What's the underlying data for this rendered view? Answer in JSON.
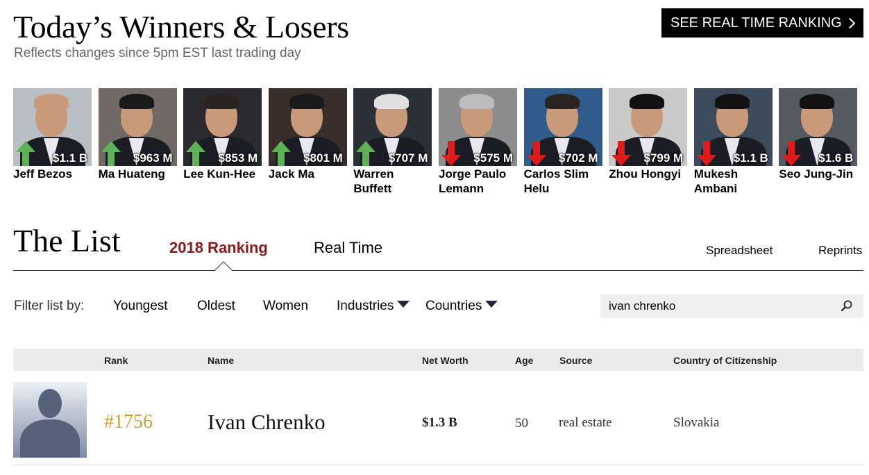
{
  "header": {
    "title": "Today’s Winners & Losers",
    "subtitle": "Reflects changes since 5pm EST last trading day",
    "realtime_button": "SEE REAL TIME RANKING"
  },
  "colors": {
    "gain": "#5fb157",
    "loss": "#e01b1b",
    "tab_active": "#8b1a1a",
    "rank": "#c9a237"
  },
  "movers": [
    {
      "name": "Jeff Bezos",
      "change": "$1.1 B",
      "direction": "up"
    },
    {
      "name": "Ma Huateng",
      "change": "$963 M",
      "direction": "up"
    },
    {
      "name": "Lee Kun-Hee",
      "change": "$853 M",
      "direction": "up"
    },
    {
      "name": "Jack Ma",
      "change": "$801 M",
      "direction": "up"
    },
    {
      "name": "Warren Buffett",
      "change": "$707 M",
      "direction": "up"
    },
    {
      "name": "Jorge Paulo Lemann",
      "change": "$575 M",
      "direction": "down"
    },
    {
      "name": "Carlos Slim Helu",
      "change": "$702 M",
      "direction": "down"
    },
    {
      "name": "Zhou Hongyi",
      "change": "$799 M",
      "direction": "down"
    },
    {
      "name": "Mukesh Ambani",
      "change": "$1.1 B",
      "direction": "down"
    },
    {
      "name": "Seo Jung-Jin",
      "change": "$1.6 B",
      "direction": "down"
    }
  ],
  "list": {
    "title": "The List",
    "tabs": {
      "ranking": "2018 Ranking",
      "realtime": "Real Time"
    },
    "links": {
      "spreadsheet": "Spreadsheet",
      "reprints": "Reprints"
    }
  },
  "filters": {
    "label": "Filter list by:",
    "youngest": "Youngest",
    "oldest": "Oldest",
    "women": "Women",
    "industries": "Industries",
    "countries": "Countries"
  },
  "search": {
    "value": "ivan chrenko"
  },
  "table": {
    "headers": {
      "rank": "Rank",
      "name": "Name",
      "net_worth": "Net Worth",
      "age": "Age",
      "source": "Source",
      "country": "Country of Citizenship"
    },
    "rows": [
      {
        "rank": "#1756",
        "name": "Ivan Chrenko",
        "net_worth": "$1.3 B",
        "age": "50",
        "source": "real estate",
        "country": "Slovakia"
      }
    ]
  }
}
